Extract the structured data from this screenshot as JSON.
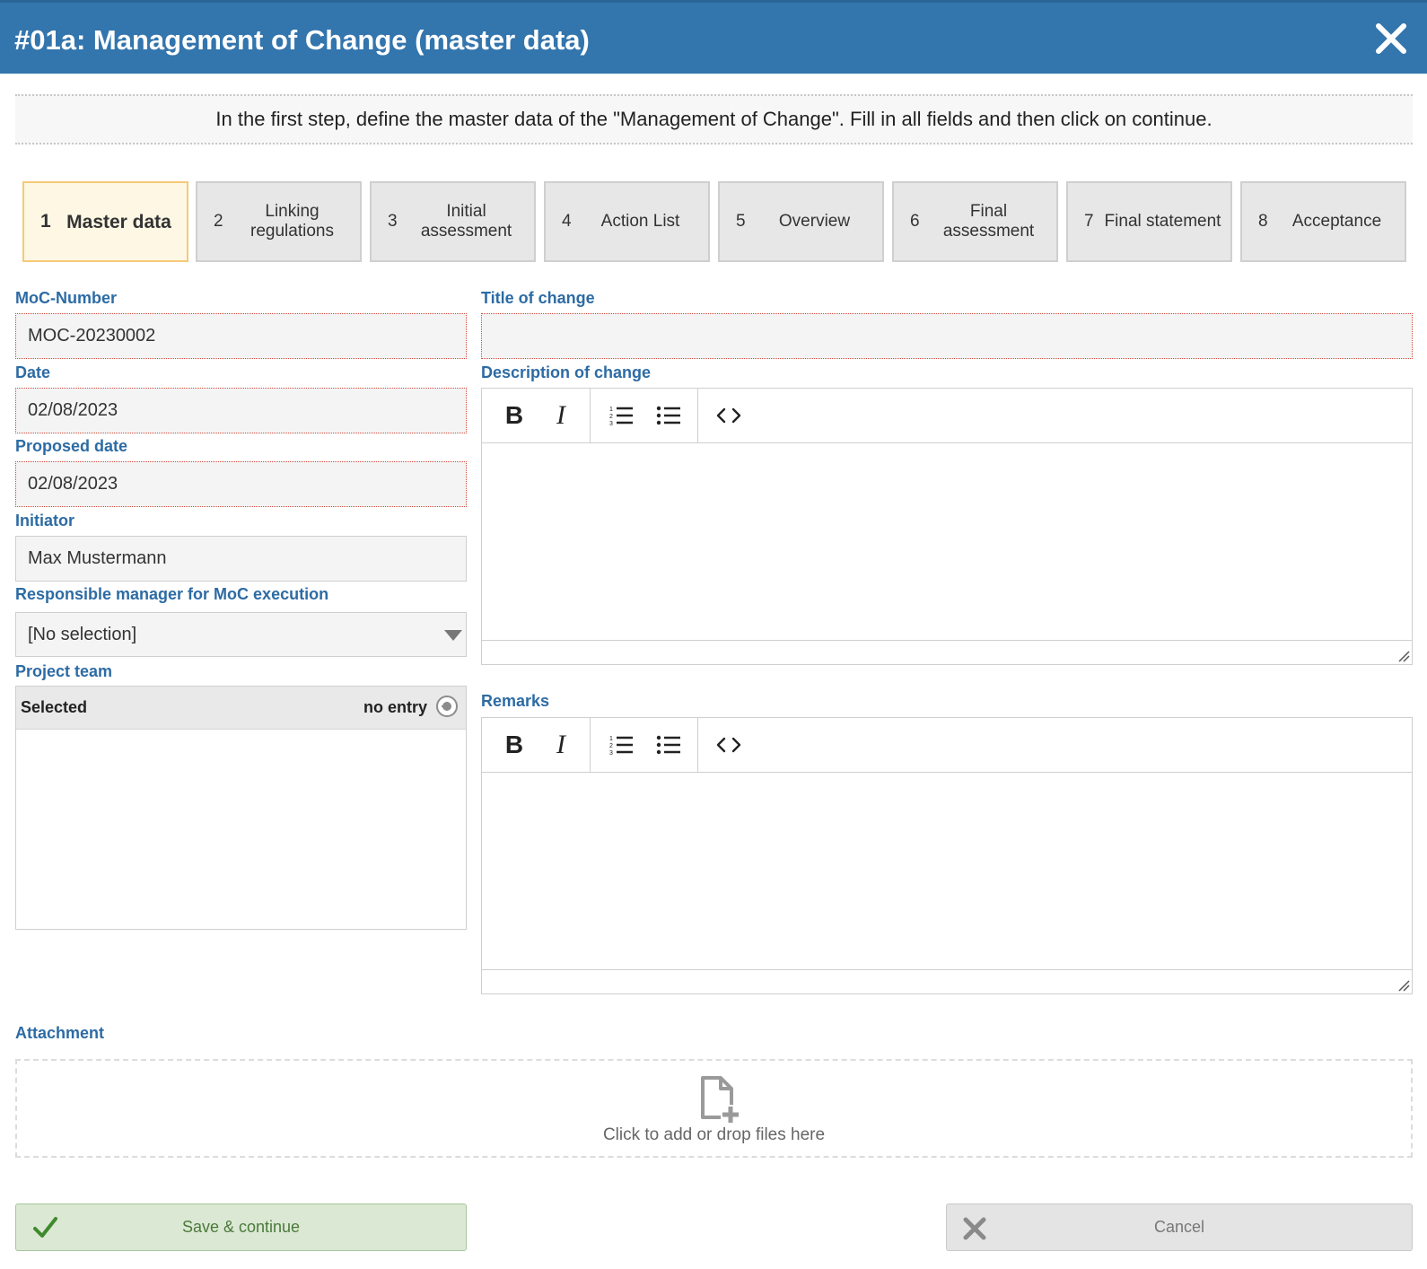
{
  "window": {
    "title": "#01a: Management of Change (master data)",
    "close_icon": "close-icon"
  },
  "instruction": "In the first step, define the master data of the \"Management of Change\". Fill in all fields and then click on continue.",
  "steps": [
    {
      "num": "1",
      "label": "Master data",
      "active": true
    },
    {
      "num": "2",
      "label": "Linking regulations"
    },
    {
      "num": "3",
      "label": "Initial assessment"
    },
    {
      "num": "4",
      "label": "Action List"
    },
    {
      "num": "5",
      "label": "Overview"
    },
    {
      "num": "6",
      "label": "Final assessment"
    },
    {
      "num": "7",
      "label": "Final statement"
    },
    {
      "num": "8",
      "label": "Acceptance"
    }
  ],
  "form": {
    "moc_number": {
      "label": "MoC-Number",
      "value": "MOC-20230002"
    },
    "date": {
      "label": "Date",
      "value": "02/08/2023"
    },
    "proposed_date": {
      "label": "Proposed date",
      "value": "02/08/2023"
    },
    "initiator": {
      "label": "Initiator",
      "value": "Max Mustermann"
    },
    "responsible_manager": {
      "label": "Responsible manager for MoC execution",
      "value": "[No selection]"
    },
    "project_team": {
      "label": "Project team",
      "selected_label": "Selected",
      "status": "no entry"
    },
    "title_of_change": {
      "label": "Title of change",
      "value": ""
    },
    "description": {
      "label": "Description of change"
    },
    "remarks": {
      "label": "Remarks"
    },
    "attachment": {
      "label": "Attachment",
      "hint": "Click to add or drop files here"
    }
  },
  "editor_toolbar": [
    "bold-icon",
    "italic-icon",
    "ordered-list-icon",
    "bullet-list-icon",
    "code-icon"
  ],
  "actions": {
    "save_label": "Save & continue",
    "cancel_label": "Cancel"
  },
  "colors": {
    "header": "#3375ad",
    "label": "#2d6ba4",
    "active_step": "#fdf7e4",
    "required_border": "#d24d3c",
    "save": "#dbe8d3"
  }
}
